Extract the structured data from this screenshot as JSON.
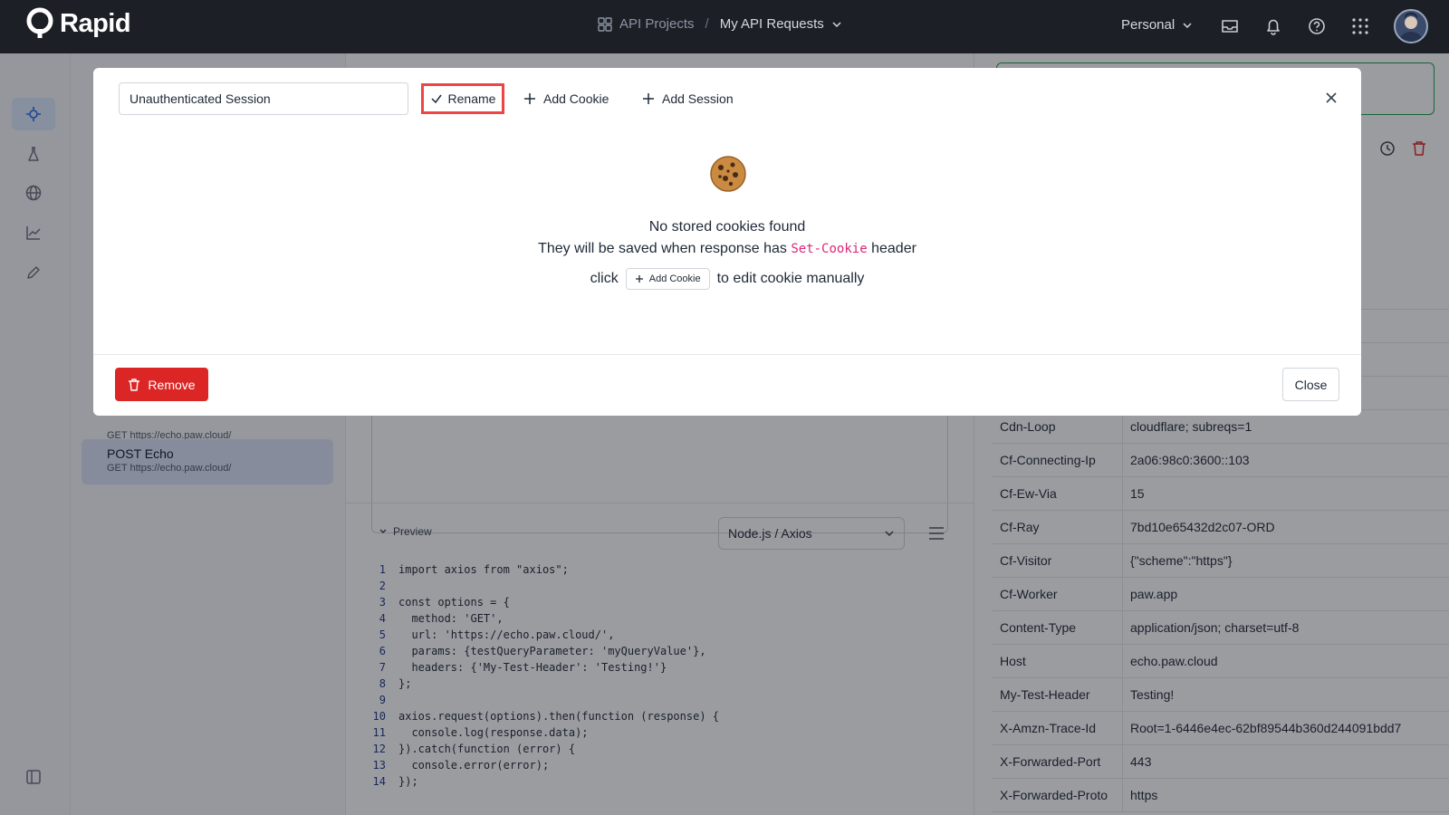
{
  "topbar": {
    "brand": "Rapid",
    "crumb_projects": "API Projects",
    "crumb_separator": "/",
    "crumb_requests": "My API Requests",
    "workspace": "Personal"
  },
  "sidebar": {
    "requests": [
      {
        "name": "",
        "url": "GET https://echo.paw.cloud/"
      },
      {
        "name": "POST Echo",
        "url": "GET https://echo.paw.cloud/"
      }
    ]
  },
  "preview": {
    "label": "Preview",
    "language": "Node.js / Axios",
    "code": [
      {
        "n": "1",
        "text": "import axios from \"axios\";"
      },
      {
        "n": "2",
        "text": ""
      },
      {
        "n": "3",
        "text": "const options = {"
      },
      {
        "n": "4",
        "text": "  method: 'GET',"
      },
      {
        "n": "5",
        "text": "  url: 'https://echo.paw.cloud/',"
      },
      {
        "n": "6",
        "text": "  params: {testQueryParameter: 'myQueryValue'},"
      },
      {
        "n": "7",
        "text": "  headers: {'My-Test-Header': 'Testing!'}"
      },
      {
        "n": "8",
        "text": "};"
      },
      {
        "n": "9",
        "text": ""
      },
      {
        "n": "10",
        "text": "axios.request(options).then(function (response) {"
      },
      {
        "n": "11",
        "text": "  console.log(response.data);"
      },
      {
        "n": "12",
        "text": "}).catch(function (error) {"
      },
      {
        "n": "13",
        "text": "  console.error(error);"
      },
      {
        "n": "14",
        "text": "});"
      }
    ]
  },
  "response_headers": [
    {
      "key": "",
      "value": ""
    },
    {
      "key": "",
      "value": ""
    },
    {
      "key": "",
      "value": ""
    },
    {
      "key": "Cdn-Loop",
      "value": "cloudflare; subreqs=1"
    },
    {
      "key": "Cf-Connecting-Ip",
      "value": "2a06:98c0:3600::103"
    },
    {
      "key": "Cf-Ew-Via",
      "value": "15"
    },
    {
      "key": "Cf-Ray",
      "value": "7bd10e65432d2c07-ORD"
    },
    {
      "key": "Cf-Visitor",
      "value": "{\"scheme\":\"https\"}"
    },
    {
      "key": "Cf-Worker",
      "value": "paw.app"
    },
    {
      "key": "Content-Type",
      "value": "application/json; charset=utf-8"
    },
    {
      "key": "Host",
      "value": "echo.paw.cloud"
    },
    {
      "key": "My-Test-Header",
      "value": "Testing!"
    },
    {
      "key": "X-Amzn-Trace-Id",
      "value": "Root=1-6446e4ec-62bf89544b360d244091bdd7"
    },
    {
      "key": "X-Forwarded-Port",
      "value": "443"
    },
    {
      "key": "X-Forwarded-Proto",
      "value": "https"
    }
  ],
  "modal": {
    "session_name": "Unauthenticated Session",
    "rename_label": "Rename",
    "add_cookie_label": "Add Cookie",
    "add_session_label": "Add Session",
    "empty_title": "No stored cookies found",
    "empty_sub_before": "They will be saved when response has",
    "empty_sub_code": "Set-Cookie",
    "empty_sub_after": "header",
    "click_before": "click",
    "click_button": "Add Cookie",
    "click_after": "to edit cookie manually",
    "remove_label": "Remove",
    "close_label": "Close"
  },
  "colors": {
    "topbar": "#1c1f26",
    "danger": "#dc2626",
    "highlight": "#ef4444",
    "success": "#16a34a",
    "code_pink": "#db2777"
  }
}
